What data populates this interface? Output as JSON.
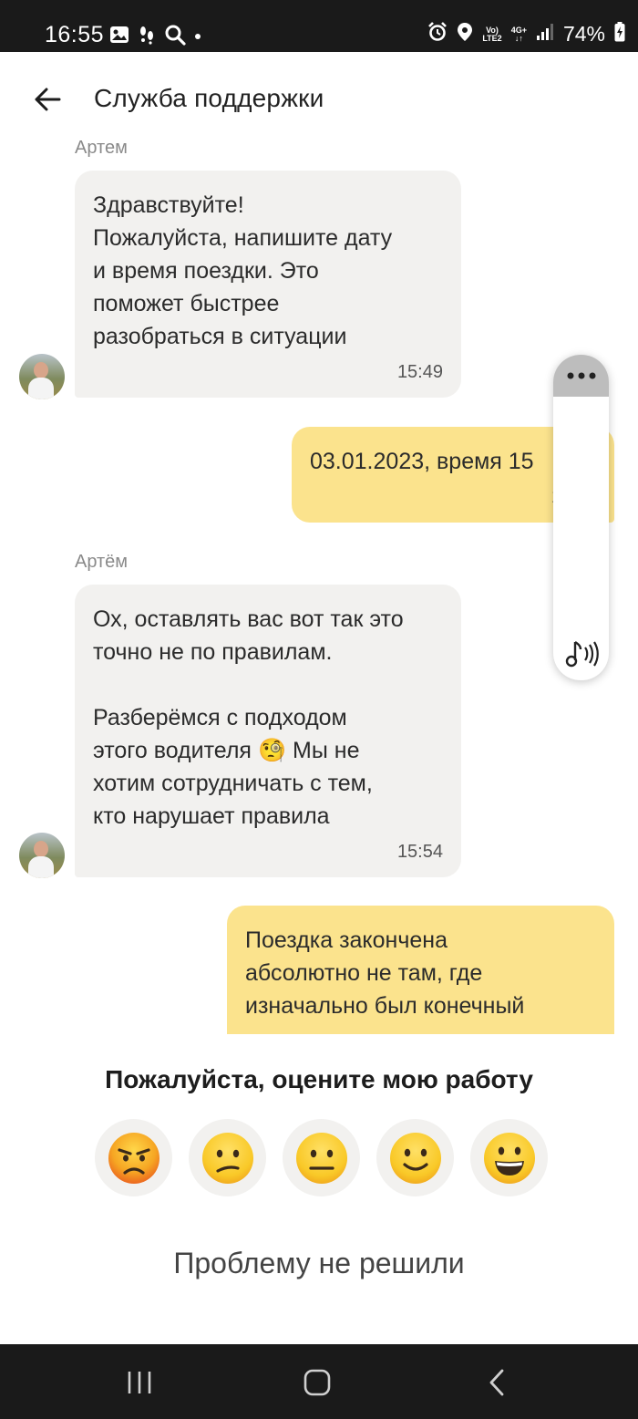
{
  "status_bar": {
    "time": "16:55",
    "battery": "74%",
    "network_top": "Vo)",
    "network_bottom": "LTE2",
    "data_type": "4G+"
  },
  "header": {
    "title": "Служба поддержки"
  },
  "messages": [
    {
      "sender": "Артем",
      "text": "Здравствуйте!\nПожалуйста, напишите дату\nи время поездки. Это\nпоможет быстрее\nразобраться в ситуации",
      "time": "15:49"
    },
    {
      "text": "03.01.2023, время 15",
      "time": "1"
    },
    {
      "sender": "Артём",
      "text_part1": "Ох, оставлять вас вот так это\nточно не по правилам.\n\nРазберёмся с подходом\nэтого водителя",
      "emoji": "🧐",
      "text_part2": " Мы не\nхотим сотрудничать с тем,\nкто нарушает правила",
      "time": "15:54"
    },
    {
      "text": "Поездка закончена\nабсолютно не там, где\nизначально был конечный"
    }
  ],
  "rating": {
    "title": "Пожалуйста, оцените мою работу"
  },
  "not_solved_label": "Проблему не решили",
  "colors": {
    "incoming_bubble": "#f2f1ef",
    "outgoing_bubble": "#fbe38d",
    "system_bars": "#1a1a1a",
    "emoji_yellow": "#f9c928"
  }
}
